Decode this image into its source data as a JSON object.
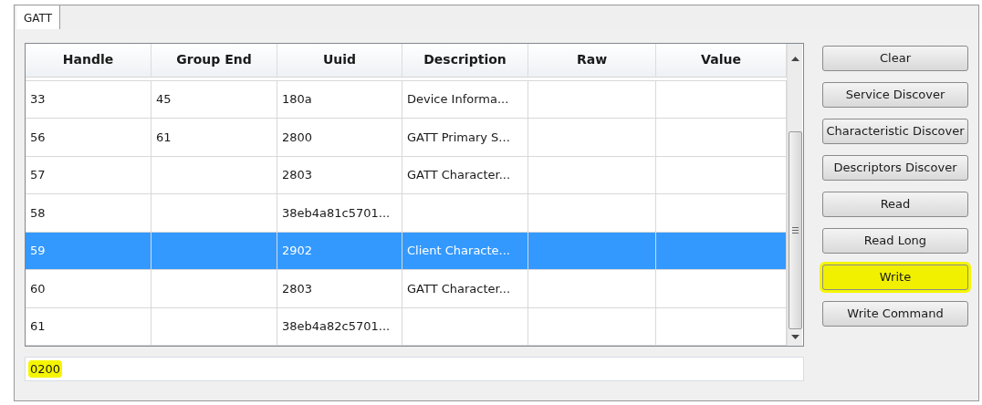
{
  "tabs": [
    {
      "label": "GATT",
      "selected": true
    }
  ],
  "table": {
    "columns": [
      "Handle",
      "Group End",
      "Uuid",
      "Description",
      "Raw",
      "Value"
    ],
    "rows": [
      {
        "cells": [
          "33",
          "45",
          "180a",
          "Device Informa...",
          "",
          ""
        ],
        "selected": false
      },
      {
        "cells": [
          "56",
          "61",
          "2800",
          "GATT Primary S...",
          "",
          ""
        ],
        "selected": false
      },
      {
        "cells": [
          "57",
          "",
          "2803",
          "GATT Character...",
          "",
          ""
        ],
        "selected": false
      },
      {
        "cells": [
          "58",
          "",
          "38eb4a81c5701...",
          "",
          "",
          ""
        ],
        "selected": false
      },
      {
        "cells": [
          "59",
          "",
          "2902",
          "Client Characte...",
          "",
          ""
        ],
        "selected": true
      },
      {
        "cells": [
          "60",
          "",
          "2803",
          "GATT Character...",
          "",
          ""
        ],
        "selected": false
      },
      {
        "cells": [
          "61",
          "",
          "38eb4a82c5701...",
          "",
          "",
          ""
        ],
        "selected": false
      }
    ]
  },
  "buttons": [
    {
      "label": "Clear",
      "highlighted": false
    },
    {
      "label": "Service Discover",
      "highlighted": false
    },
    {
      "label": "Characteristic Discover",
      "highlighted": false
    },
    {
      "label": "Descriptors Discover",
      "highlighted": false
    },
    {
      "label": "Read",
      "highlighted": false
    },
    {
      "label": "Read Long",
      "highlighted": false
    },
    {
      "label": "Write",
      "highlighted": true
    },
    {
      "label": "Write Command",
      "highlighted": false
    }
  ],
  "value_field": {
    "value": "0200",
    "highlighted": true
  }
}
